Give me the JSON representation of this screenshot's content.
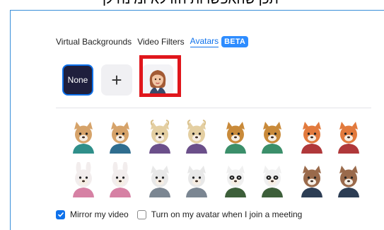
{
  "caption": "ייתכן שהאפשרות הזו לא זמינה לך",
  "tabs": [
    {
      "label": "Virtual Backgrounds"
    },
    {
      "label": "Video Filters"
    },
    {
      "label": "Avatars"
    }
  ],
  "badge": "BETA",
  "thumbs": {
    "none_label": "None",
    "add_label": "+"
  },
  "avatars": [
    {
      "name": "cat-teal",
      "fur": "#d6a36a",
      "shirt": "#2f8f8a"
    },
    {
      "name": "cat-blue",
      "fur": "#d6a36a",
      "shirt": "#2f6d8f"
    },
    {
      "name": "cow-purple",
      "fur": "#e4cfa2",
      "shirt": "#6b4f8a"
    },
    {
      "name": "cow-purple-2",
      "fur": "#e4cfa2",
      "shirt": "#6b4f8a"
    },
    {
      "name": "dog-green",
      "fur": "#c98a3a",
      "shirt": "#3b8f6a"
    },
    {
      "name": "dog-green-2",
      "fur": "#c98a3a",
      "shirt": "#3b8f6a"
    },
    {
      "name": "fox-red",
      "fur": "#e27a3d",
      "shirt": "#b0383a"
    },
    {
      "name": "fox-red-2",
      "fur": "#e27a3d",
      "shirt": "#b0383a"
    },
    {
      "name": "rabbit-pink",
      "fur": "#f2eded",
      "shirt": "#d681a4"
    },
    {
      "name": "rabbit-pink-2",
      "fur": "#f2eded",
      "shirt": "#d681a4"
    },
    {
      "name": "bear-white-grey",
      "fur": "#e8e8e8",
      "shirt": "#7b8692"
    },
    {
      "name": "bear-white-grey-2",
      "fur": "#e8e8e8",
      "shirt": "#7b8692"
    },
    {
      "name": "panda-green",
      "fur": "#f0f0f0",
      "shirt": "#3d5f3a"
    },
    {
      "name": "panda-green-2",
      "fur": "#f0f0f0",
      "shirt": "#3d5f3a"
    },
    {
      "name": "otter-navy",
      "fur": "#9a6a4b",
      "shirt": "#2c3d54"
    },
    {
      "name": "otter-navy-2",
      "fur": "#9a6a4b",
      "shirt": "#2c3d54"
    }
  ],
  "options": {
    "mirror_label": "Mirror my video",
    "mirror_checked": true,
    "avatar_join_label": "Turn on my avatar when I join a meeting",
    "avatar_join_checked": false
  },
  "colors": {
    "accent": "#0e71eb",
    "highlight": "#e0161c",
    "badge": "#2d8cff"
  }
}
